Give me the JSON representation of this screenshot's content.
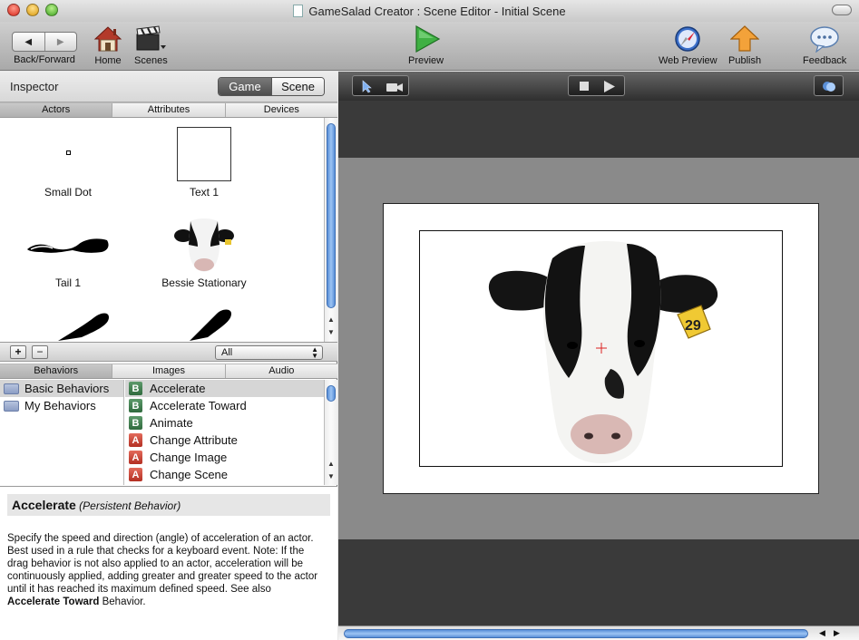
{
  "window": {
    "title": "GameSalad Creator : Scene Editor - Initial Scene"
  },
  "toolbar": {
    "back_forward": "Back/Forward",
    "home": "Home",
    "scenes": "Scenes",
    "preview": "Preview",
    "web_preview": "Web Preview",
    "publish": "Publish",
    "feedback": "Feedback"
  },
  "inspector": {
    "title": "Inspector",
    "segments": [
      "Game",
      "Scene"
    ],
    "selected_segment": "Game",
    "top_tabs": [
      "Actors",
      "Attributes",
      "Devices"
    ],
    "actors": [
      {
        "name": "Small Dot"
      },
      {
        "name": "Text 1"
      },
      {
        "name": "Tail 1"
      },
      {
        "name": "Bessie Stationary"
      }
    ],
    "filter_value": "All",
    "add_label": "+",
    "remove_label": "−",
    "bottom_tabs": [
      "Behaviors",
      "Images",
      "Audio"
    ]
  },
  "behaviors": {
    "folders": [
      {
        "label": "Basic Behaviors",
        "selected": true
      },
      {
        "label": "My Behaviors",
        "selected": false
      }
    ],
    "items": [
      {
        "badge": "B",
        "label": "Accelerate",
        "selected": true
      },
      {
        "badge": "B",
        "label": "Accelerate Toward",
        "selected": false
      },
      {
        "badge": "B",
        "label": "Animate",
        "selected": false
      },
      {
        "badge": "A",
        "label": "Change Attribute",
        "selected": false
      },
      {
        "badge": "A",
        "label": "Change Image",
        "selected": false
      },
      {
        "badge": "A",
        "label": "Change Scene",
        "selected": false
      }
    ]
  },
  "description": {
    "title": "Accelerate",
    "subtitle": "(Persistent Behavior)",
    "body": "Specify the speed and direction (angle) of acceleration of an actor. Best used in a rule that checks for a keyboard event. Note: If the drag behavior is not also applied to an actor, acceleration will be continuously applied, adding greater and greater speed to the actor until it has reached its maximum defined speed. See also ",
    "link": "Accelerate Toward",
    "tail": " Behavior."
  },
  "scene": {
    "tag_number": "29"
  },
  "colors": {
    "selection": "#d6d6d6",
    "badge_b": "#3f7a4d",
    "badge_a": "#c43a2c",
    "scroll_accent": "#5a8fd8"
  }
}
